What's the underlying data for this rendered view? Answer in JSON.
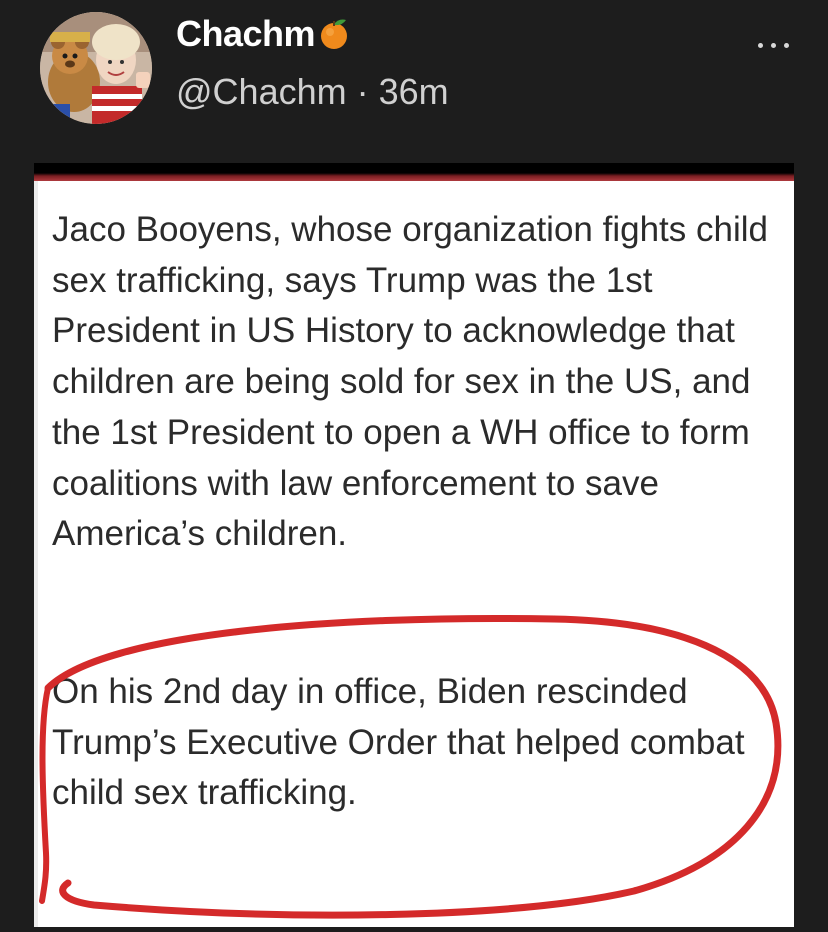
{
  "post": {
    "display_name": "Chachm",
    "name_emoji_icon": "tangerine-icon",
    "handle": "@Chachm",
    "separator": "·",
    "time_ago": "36m",
    "more_icon": "more-horizontal-icon"
  },
  "image": {
    "paragraph_1": "Jaco Booyens, whose organization fights child sex trafficking, says Trump was the 1st President in US History to acknowledge that children are being sold for sex in the US, and the 1st President to open a WH office to form coalitions with law enforcement to save America’s children.",
    "paragraph_2": "On his 2nd day in office, Biden rescinded Trump’s Executive Order that helped combat child sex trafficking.",
    "circle_color": "#d42a2a"
  },
  "colors": {
    "background": "#1d1d1d",
    "name_text": "#ffffff",
    "handle_text": "#d0d0d0",
    "body_text": "#2b2b2b"
  }
}
